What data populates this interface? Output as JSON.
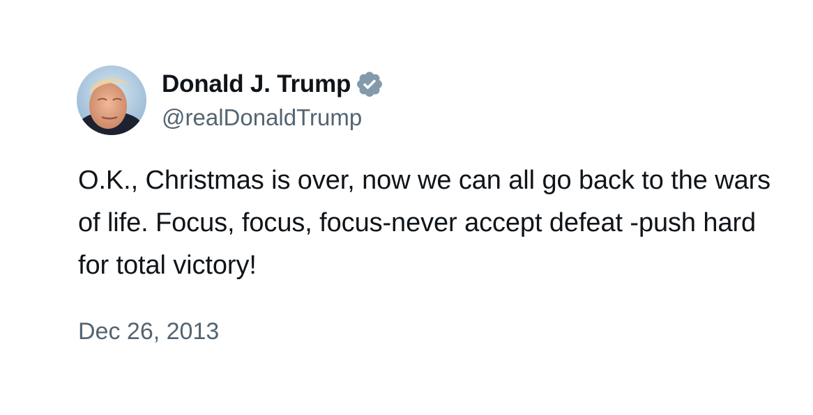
{
  "author": {
    "display_name": "Donald J. Trump",
    "handle": "@realDonaldTrump",
    "verified": true,
    "badge_color": "#829aab"
  },
  "tweet": {
    "text": "O.K., Christmas is over, now we can all go back to the wars of life. Focus, focus, focus-never accept defeat -push hard for total victory!",
    "date": "Dec 26, 2013"
  },
  "colors": {
    "text_primary": "#0f1419",
    "text_secondary": "#536471",
    "background": "#ffffff"
  }
}
